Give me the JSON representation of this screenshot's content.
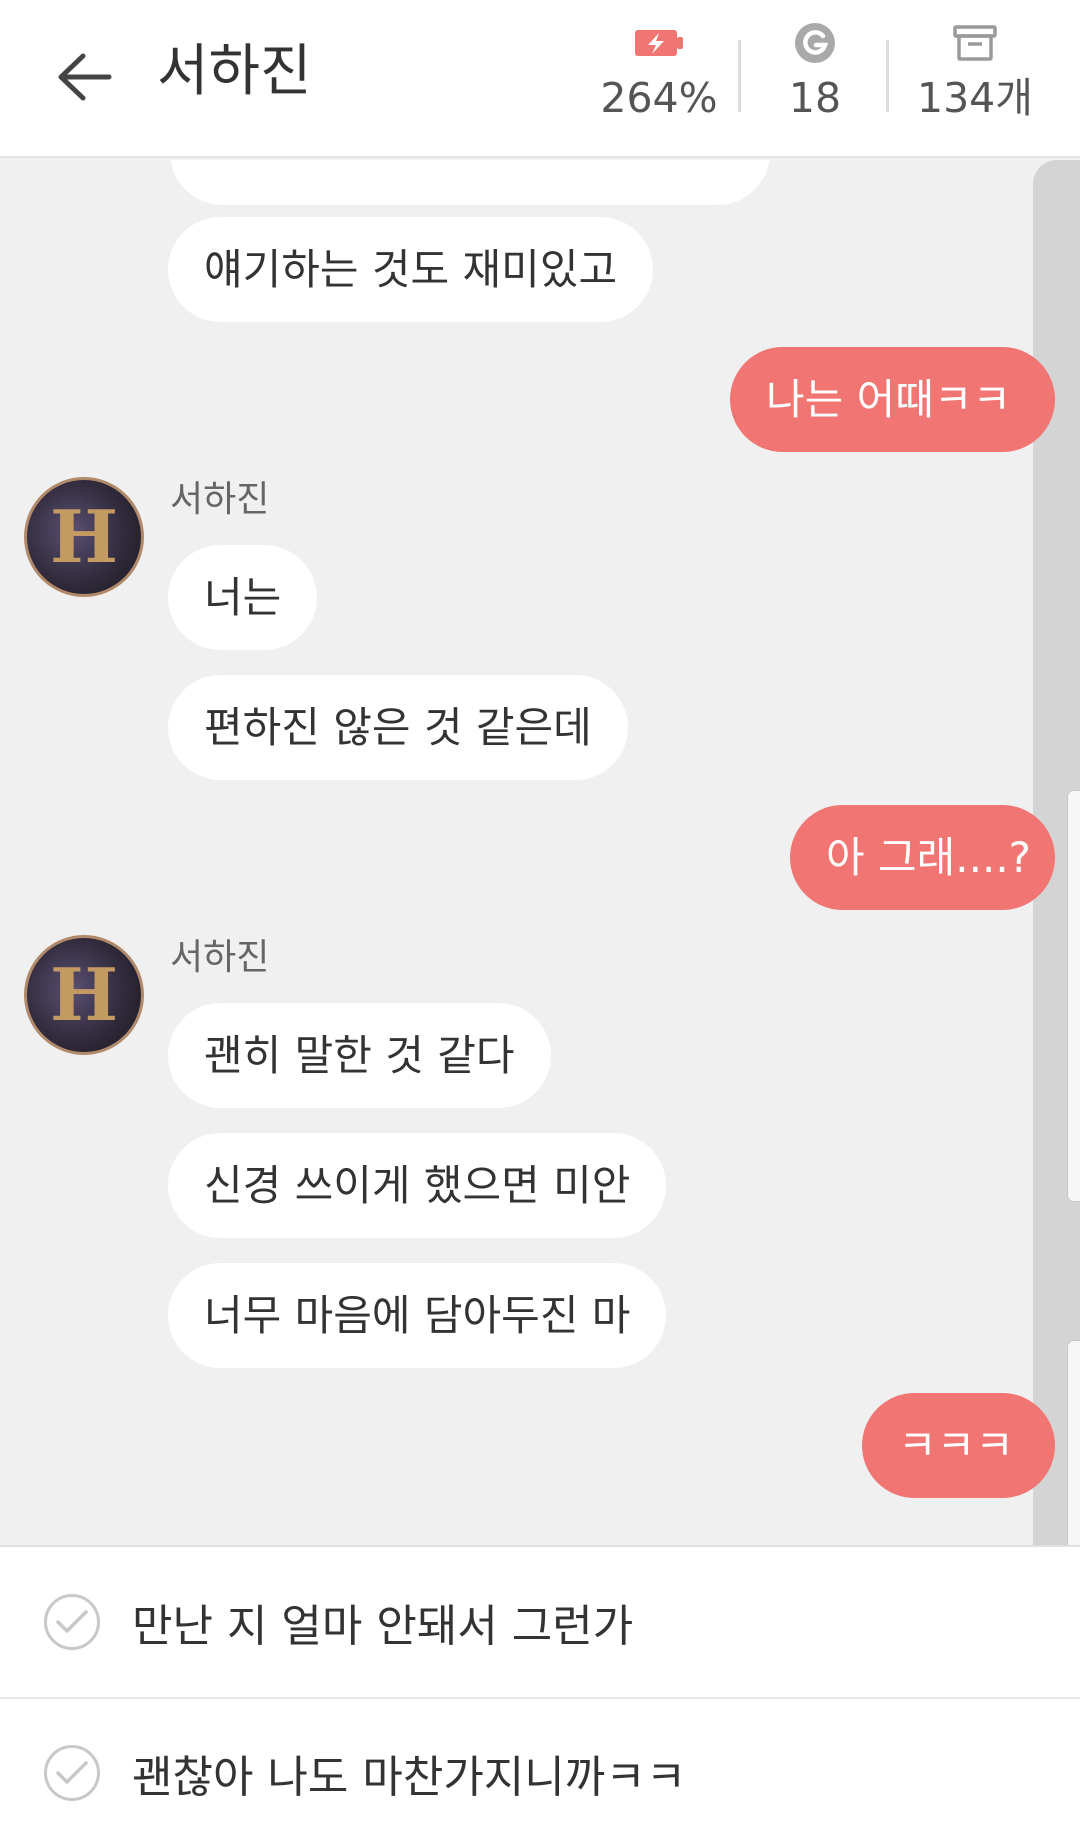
{
  "header": {
    "title": "서하진",
    "battery": {
      "icon": "battery-charging-icon",
      "value": "264%"
    },
    "gems": {
      "icon": "g-coin-icon",
      "value": "18"
    },
    "items": {
      "icon": "archive-box-icon",
      "value": "134개"
    }
  },
  "contact": {
    "name": "서하진",
    "avatar_letter": "H"
  },
  "messages": [
    {
      "side": "in",
      "text": "얘기하는 것도 재미있고"
    },
    {
      "side": "out",
      "text": "나는 어때ㅋㅋ"
    },
    {
      "side": "in",
      "sender": "서하진",
      "text": "너는"
    },
    {
      "side": "in",
      "text": "편하진 않은 것 같은데"
    },
    {
      "side": "out",
      "text": "아 그래....?"
    },
    {
      "side": "in",
      "sender": "서하진",
      "text": "괜히 말한 것 같다"
    },
    {
      "side": "in",
      "text": "신경 쓰이게 했으면 미안"
    },
    {
      "side": "in",
      "text": "너무 마음에 담아두진 마"
    },
    {
      "side": "out",
      "text": "ㅋㅋㅋ"
    }
  ],
  "reply_options": [
    {
      "text": "만난 지 얼마 안돼서 그런가"
    },
    {
      "text": "괜찮아 나도 마찬가지니까ㅋㅋ"
    }
  ],
  "colors": {
    "accent": "#f07573",
    "background": "#f0f0f0",
    "bubble_in": "#ffffff"
  }
}
